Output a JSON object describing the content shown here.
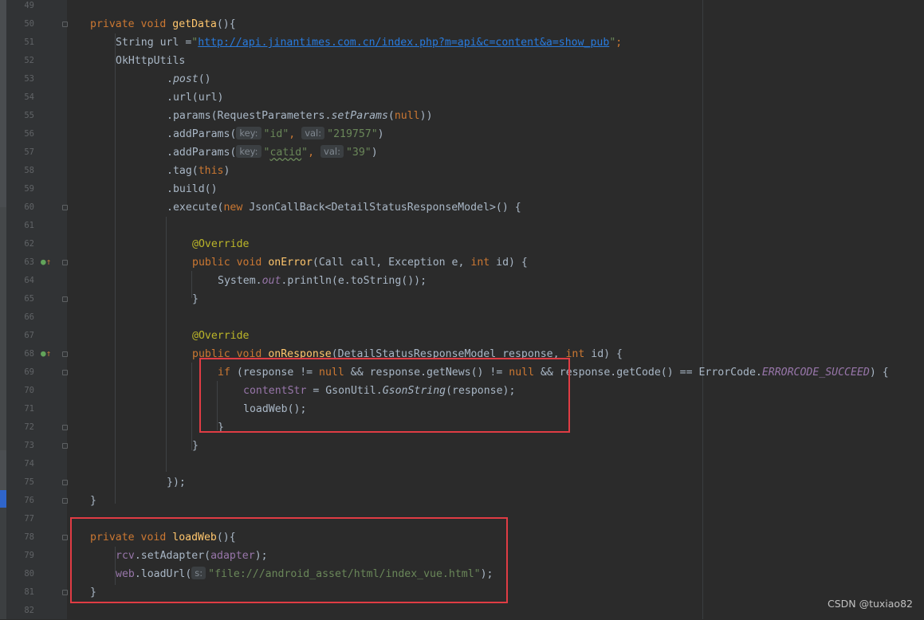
{
  "line_numbers": [
    "49",
    "50",
    "51",
    "52",
    "53",
    "54",
    "55",
    "56",
    "57",
    "58",
    "59",
    "60",
    "61",
    "62",
    "63",
    "64",
    "65",
    "66",
    "67",
    "68",
    "69",
    "70",
    "71",
    "72",
    "73",
    "74",
    "75",
    "76",
    "77",
    "78",
    "79",
    "80",
    "81",
    "82"
  ],
  "code": {
    "l50": {
      "kw1": "private",
      "kw2": "void",
      "fn": "getData",
      "rest": "(){"
    },
    "l51": {
      "type": "String url =",
      "str_open": "\"",
      "url": "http://api.jinantimes.com.cn/index.php?m=api&c=content&a=show_pub",
      "str_close": "\"",
      "semi": ";"
    },
    "l52": {
      "text": "OkHttpUtils"
    },
    "l53": {
      "dot": ".",
      "m": "post",
      "rest": "()"
    },
    "l54": {
      "text": ".url(url)"
    },
    "l55": {
      "pre": ".params(RequestParameters.",
      "m": "setParams",
      "mid": "(",
      "kw": "null",
      "post": "))"
    },
    "l56": {
      "pre": ".addParams(",
      "hint1": "key:",
      "s1": "\"id\"",
      "comma": ",",
      "hint2": "val:",
      "s2": "\"219757\"",
      "post": ")"
    },
    "l57": {
      "pre": ".addParams(",
      "hint1": "key:",
      "s1a": "\"",
      "s1b": "catid",
      "s1c": "\"",
      "comma": ",",
      "hint2": "val:",
      "s2": "\"39\"",
      "post": ")"
    },
    "l58": {
      "pre": ".tag(",
      "kw": "this",
      "post": ")"
    },
    "l59": {
      "text": ".build()"
    },
    "l60": {
      "pre": ".execute(",
      "kw": "new",
      "post": " JsonCallBack<DetailStatusResponseModel>() {"
    },
    "l62": {
      "ann": "@Override"
    },
    "l63": {
      "kw1": "public",
      "kw2": "void",
      "fn": "onError",
      "a": "(Call call, Exception e, ",
      "kw3": "int",
      "b": " id) {"
    },
    "l64": {
      "a": "System.",
      "field": "out",
      "b": ".println(e.toString());"
    },
    "l65": {
      "text": "}"
    },
    "l67": {
      "ann": "@Override"
    },
    "l68": {
      "kw1": "public",
      "kw2": "void",
      "fn": "onResponse",
      "a": "(DetailStatusResponseModel response, ",
      "kw3": "int",
      "b": " id) {"
    },
    "l69": {
      "kw1": "if",
      "a": " (response != ",
      "kw2": "null",
      "b": " && response.getNews() != ",
      "kw3": "null",
      "c": " && response.getCode() == ErrorCode.",
      "field": "ERRORCODE_SUCCEED",
      "d": ") {"
    },
    "l70": {
      "field": "contentStr",
      "a": " = GsonUtil.",
      "m": "GsonString",
      "b": "(response);"
    },
    "l71": {
      "text": "loadWeb();"
    },
    "l72": {
      "text": "}"
    },
    "l73": {
      "text": "}"
    },
    "l75": {
      "text": "});"
    },
    "l76": {
      "text": "}"
    },
    "l78": {
      "kw1": "private",
      "kw2": "void",
      "fn": "loadWeb",
      "rest": "(){"
    },
    "l79": {
      "field": "rcv",
      "a": ".setAdapter(",
      "field2": "adapter",
      "b": ");"
    },
    "l80": {
      "field": "web",
      "a": ".loadUrl(",
      "hint": "s:",
      "str": "\"file:///android_asset/html/index_vue.html\"",
      "b": ");"
    },
    "l81": {
      "text": "}"
    }
  },
  "watermark": "CSDN @tuxiao82",
  "colors": {
    "background": "#2b2b2b",
    "gutter": "#313335",
    "keyword": "#cc7832",
    "method": "#ffc66d",
    "string": "#6a8759",
    "highlight_box": "#e03c44"
  }
}
